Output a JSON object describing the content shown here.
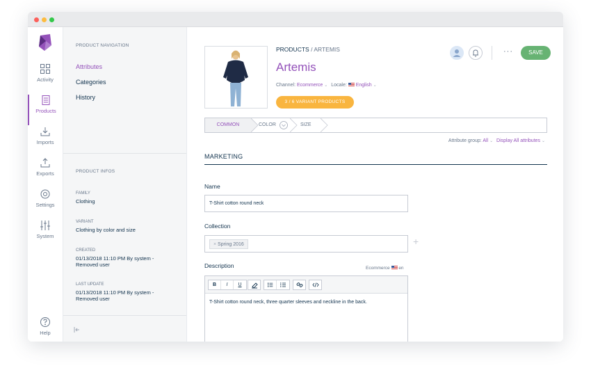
{
  "main_nav": [
    {
      "label": "Activity",
      "icon": "activity-icon"
    },
    {
      "label": "Products",
      "icon": "products-icon"
    },
    {
      "label": "Imports",
      "icon": "imports-icon"
    },
    {
      "label": "Exports",
      "icon": "exports-icon"
    },
    {
      "label": "Settings",
      "icon": "settings-icon"
    },
    {
      "label": "System",
      "icon": "system-icon"
    }
  ],
  "help_label": "Help",
  "product_navigation": {
    "title": "PRODUCT NAVIGATION",
    "items": [
      "Attributes",
      "Categories",
      "History"
    ]
  },
  "product_infos": {
    "title": "PRODUCT INFOS",
    "family_label": "FAMILY",
    "family_value": "Clothing",
    "variant_label": "VARIANT",
    "variant_value": "Clothing by color and size",
    "created_label": "CREATED",
    "created_value": "01/13/2018 11:10 PM By system - Removed user",
    "updated_label": "LAST UPDATE",
    "updated_value": "01/13/2018 11:10 PM By system - Removed user"
  },
  "header": {
    "breadcrumb_root": "PRODUCTS",
    "breadcrumb_sep": " / ",
    "breadcrumb_current": "ARTEMIS",
    "title": "Artemis",
    "channel_label": "Channel:",
    "channel_value": "Ecommerce",
    "locale_label": "Locale:",
    "locale_value": "English",
    "variant_button": "3 / 6 VARIANT PRODUCTS",
    "more": "···",
    "save": "SAVE"
  },
  "tabs": [
    "COMMON",
    "COLOR",
    "SIZE"
  ],
  "attribute_group": {
    "label": "Attribute group:",
    "value": "All",
    "display": "Display All attributes"
  },
  "section": "MARKETING",
  "fields": {
    "name_label": "Name",
    "name_value": "T-Shirt cotton round neck",
    "collection_label": "Collection",
    "collection_chip": "Spring 2016",
    "description_label": "Description",
    "description_scope": "Ecommerce",
    "description_locale": "en",
    "description_text": "T-Shirt cotton round neck, three quarter sleeves and neckline in the back."
  },
  "toolbar": [
    "B",
    "I",
    "U"
  ],
  "colors": {
    "accent": "#9452ba",
    "save": "#67b373",
    "variant": "#f9b53f"
  }
}
